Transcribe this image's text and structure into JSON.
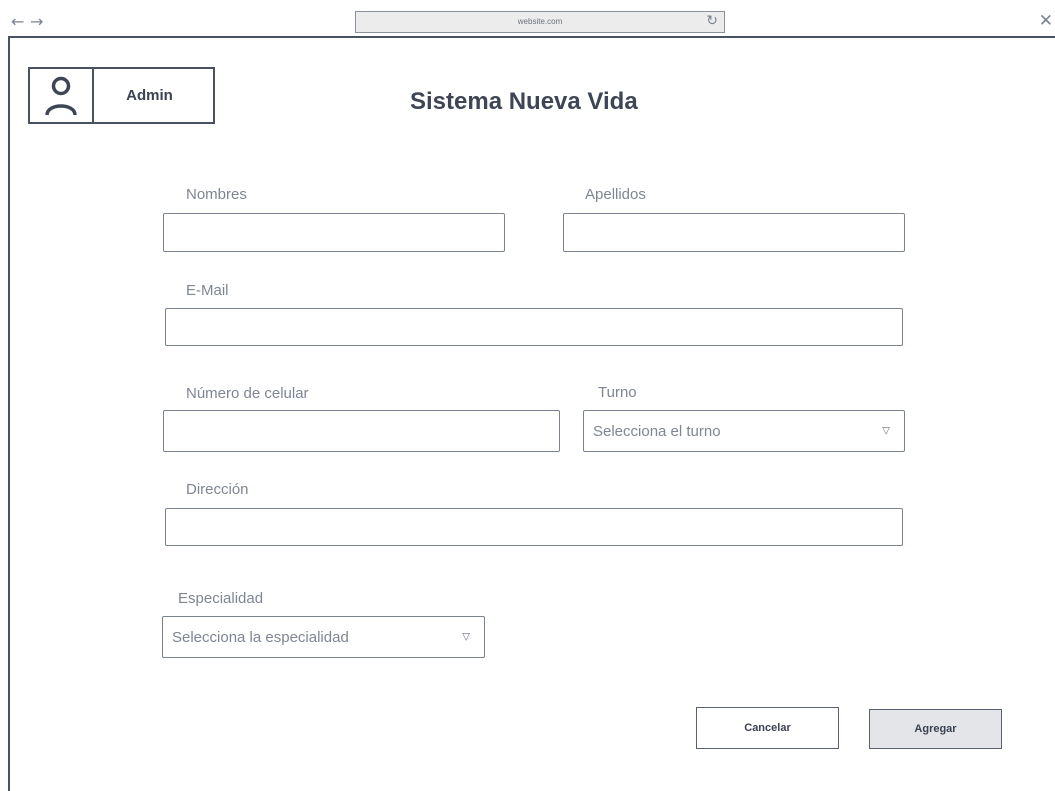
{
  "browser": {
    "url": "website.com",
    "back_icon": "back-arrow-icon",
    "forward_icon": "forward-arrow-icon",
    "reload_icon": "reload-icon",
    "close_icon": "close-icon"
  },
  "header": {
    "user_label": "Admin",
    "avatar_icon": "user-icon",
    "title": "Sistema Nueva Vida"
  },
  "form": {
    "nombres": {
      "label": "Nombres",
      "value": ""
    },
    "apellidos": {
      "label": "Apellidos",
      "value": ""
    },
    "email": {
      "label": "E-Mail",
      "value": ""
    },
    "celular": {
      "label": "Número de celular",
      "value": ""
    },
    "turno": {
      "label": "Turno",
      "selected": "Selecciona el turno"
    },
    "direccion": {
      "label": "Dirección",
      "value": ""
    },
    "especialidad": {
      "label": "Especialidad",
      "selected": "Selecciona la especialidad"
    }
  },
  "actions": {
    "cancel_label": "Cancelar",
    "add_label": "Agregar"
  }
}
